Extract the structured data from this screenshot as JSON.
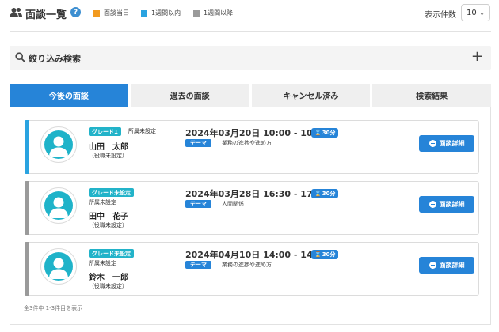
{
  "header": {
    "title": "面談一覧",
    "help_label": "?",
    "legend": [
      {
        "label": "面談当日",
        "color": "#f29a1f"
      },
      {
        "label": "1週間以内",
        "color": "#2aa3e0"
      },
      {
        "label": "1週間以降",
        "color": "#9a9a9a"
      }
    ],
    "page_size_label": "表示件数",
    "page_size_value": "10"
  },
  "search": {
    "label": "絞り込み検索",
    "toggle_label": "+"
  },
  "tabs": [
    {
      "label": "今後の面談",
      "active": true
    },
    {
      "label": "過去の面談",
      "active": false
    },
    {
      "label": "キャンセル済み",
      "active": false
    },
    {
      "label": "検索結果",
      "active": false
    }
  ],
  "interviews": [
    {
      "grade": "グレード1",
      "department": "所属未設定",
      "name": "山田　太郎",
      "role": "（役職未設定）",
      "datetime": "2024年03月20日 10:00 - 10:30",
      "duration": "30分",
      "theme_label": "テーマ",
      "theme": "業務の進捗や進め方",
      "button_label": "面談詳細",
      "status_color": "#2aa3e0"
    },
    {
      "grade": "グレード未設定",
      "department": "所属未設定",
      "name": "田中　花子",
      "role": "（役職未設定）",
      "datetime": "2024年03月28日 16:30 - 17:00",
      "duration": "30分",
      "theme_label": "テーマ",
      "theme": "人間関係",
      "button_label": "面談詳細",
      "status_color": "#9a9a9a"
    },
    {
      "grade": "グレード未設定",
      "department": "所属未設定",
      "name": "鈴木　一郎",
      "role": "（役職未設定）",
      "datetime": "2024年04月10日 14:00 - 14:30",
      "duration": "30分",
      "theme_label": "テーマ",
      "theme": "業務の進捗や進め方",
      "button_label": "面談詳細",
      "status_color": "#9a9a9a"
    }
  ],
  "summary": "全3件中 1-3件目を表示"
}
